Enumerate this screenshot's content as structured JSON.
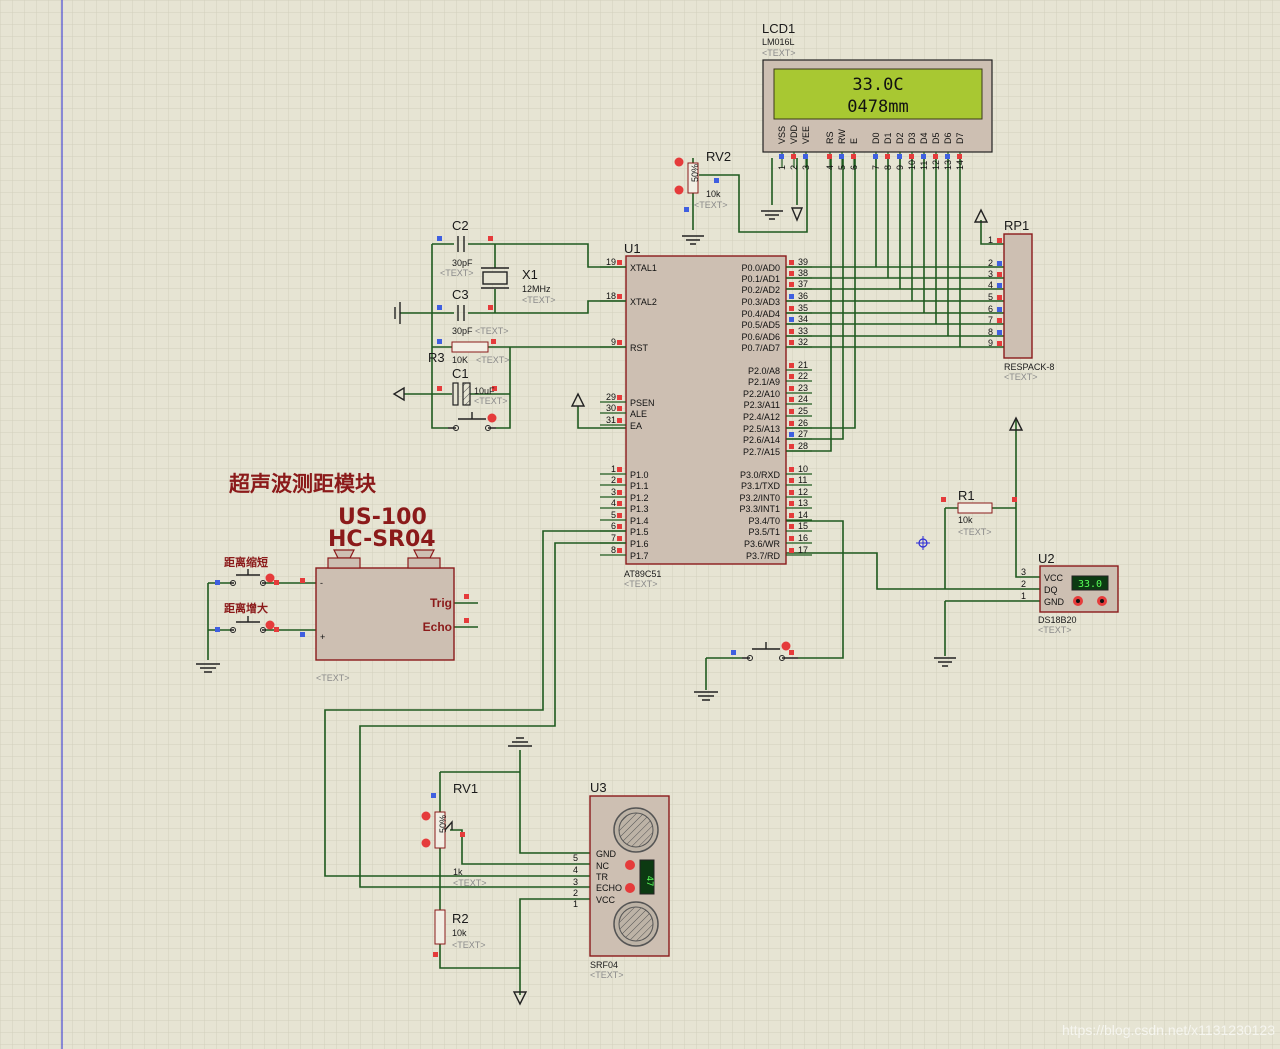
{
  "module_title": "超声波测距模块",
  "module_models": [
    "US-100",
    "HC-SR04"
  ],
  "lcd": {
    "ref": "LCD1",
    "part": "LM016L",
    "text_tag": "<TEXT>",
    "line1": "33.0C",
    "line2": "0478mm",
    "pin_labels": [
      "VSS",
      "VDD",
      "VEE",
      "RS",
      "RW",
      "E",
      "D0",
      "D1",
      "D2",
      "D3",
      "D4",
      "D5",
      "D6",
      "D7"
    ],
    "pin_numbers": [
      "1",
      "2",
      "3",
      "4",
      "5",
      "6",
      "7",
      "8",
      "9",
      "10",
      "11",
      "12",
      "13",
      "14"
    ]
  },
  "mcu": {
    "ref": "U1",
    "part": "AT89C51",
    "text_tag": "<TEXT>",
    "left_pins": [
      {
        "name": "XTAL1",
        "num": "19"
      },
      {
        "name": "XTAL2",
        "num": "18"
      },
      {
        "name": "RST",
        "num": "9"
      },
      {
        "name": "PSEN",
        "num": "29"
      },
      {
        "name": "ALE",
        "num": "30"
      },
      {
        "name": "EA",
        "num": "31"
      },
      {
        "name": "P1.0",
        "num": "1"
      },
      {
        "name": "P1.1",
        "num": "2"
      },
      {
        "name": "P1.2",
        "num": "3"
      },
      {
        "name": "P1.3",
        "num": "4"
      },
      {
        "name": "P1.4",
        "num": "5"
      },
      {
        "name": "P1.5",
        "num": "6"
      },
      {
        "name": "P1.6",
        "num": "7"
      },
      {
        "name": "P1.7",
        "num": "8"
      }
    ],
    "right_pins": [
      {
        "name": "P0.0/AD0",
        "num": "39"
      },
      {
        "name": "P0.1/AD1",
        "num": "38"
      },
      {
        "name": "P0.2/AD2",
        "num": "37"
      },
      {
        "name": "P0.3/AD3",
        "num": "36"
      },
      {
        "name": "P0.4/AD4",
        "num": "35"
      },
      {
        "name": "P0.5/AD5",
        "num": "34"
      },
      {
        "name": "P0.6/AD6",
        "num": "33"
      },
      {
        "name": "P0.7/AD7",
        "num": "32"
      },
      {
        "name": "P2.0/A8",
        "num": "21"
      },
      {
        "name": "P2.1/A9",
        "num": "22"
      },
      {
        "name": "P2.2/A10",
        "num": "23"
      },
      {
        "name": "P2.3/A11",
        "num": "24"
      },
      {
        "name": "P2.4/A12",
        "num": "25"
      },
      {
        "name": "P2.5/A13",
        "num": "26"
      },
      {
        "name": "P2.6/A14",
        "num": "27"
      },
      {
        "name": "P2.7/A15",
        "num": "28"
      },
      {
        "name": "P3.0/RXD",
        "num": "10"
      },
      {
        "name": "P3.1/TXD",
        "num": "11"
      },
      {
        "name": "P3.2/INT0",
        "num": "12"
      },
      {
        "name": "P3.3/INT1",
        "num": "13"
      },
      {
        "name": "P3.4/T0",
        "num": "14"
      },
      {
        "name": "P3.5/T1",
        "num": "15"
      },
      {
        "name": "P3.6/WR",
        "num": "16"
      },
      {
        "name": "P3.7/RD",
        "num": "17"
      }
    ]
  },
  "rp1": {
    "ref": "RP1",
    "part": "RESPACK-8",
    "text_tag": "<TEXT>",
    "pins": [
      "1",
      "2",
      "3",
      "4",
      "5",
      "6",
      "7",
      "8",
      "9"
    ]
  },
  "rv2": {
    "ref": "RV2",
    "value": "10k",
    "text_tag": "<TEXT>",
    "percent": "50%"
  },
  "c2": {
    "ref": "C2",
    "value": "30pF",
    "text_tag": "<TEXT>"
  },
  "c3": {
    "ref": "C3",
    "value": "30pF",
    "text_tag": "<TEXT>"
  },
  "x1": {
    "ref": "X1",
    "value": "12MHz",
    "text_tag": "<TEXT>"
  },
  "r3": {
    "ref": "R3",
    "value": "10K",
    "text_tag": "<TEXT>"
  },
  "c1": {
    "ref": "C1",
    "value": "10uF",
    "text_tag": "<TEXT>"
  },
  "r1": {
    "ref": "R1",
    "value": "10k",
    "text_tag": "<TEXT>"
  },
  "u2": {
    "ref": "U2",
    "part": "DS18B20",
    "text_tag": "<TEXT>",
    "pins": [
      {
        "name": "VCC",
        "num": "3"
      },
      {
        "name": "DQ",
        "num": "2"
      },
      {
        "name": "GND",
        "num": "1"
      }
    ],
    "readout": "33.0"
  },
  "rv1": {
    "ref": "RV1",
    "value": "1k",
    "text_tag": "<TEXT>",
    "percent": "50%"
  },
  "r2": {
    "ref": "R2",
    "value": "10k",
    "text_tag": "<TEXT>"
  },
  "u3": {
    "ref": "U3",
    "part": "SRF04",
    "text_tag": "<TEXT>",
    "pins": [
      {
        "name": "GND",
        "num": "5"
      },
      {
        "name": "NC",
        "num": "4"
      },
      {
        "name": "TR",
        "num": "3"
      },
      {
        "name": "ECHO",
        "num": "2"
      },
      {
        "name": "VCC",
        "num": "1"
      }
    ],
    "readout": "47"
  },
  "buttons": {
    "shorten": "距离缩短",
    "enlarge": "距离增大"
  },
  "module_box": {
    "trig": "Trig",
    "echo": "Echo",
    "minus": "-",
    "plus": "+",
    "text_tag": "<TEXT>"
  },
  "watermark": "https://blog.csdn.net/x1131230123",
  "colors": {
    "background": "#e6e4d3",
    "grid": "#d2d0bd",
    "wire": "#1f5a1f",
    "component": "#8b1a1a",
    "lcd_screen": "#a8c832",
    "chip_fill": "#cdbfb2"
  }
}
